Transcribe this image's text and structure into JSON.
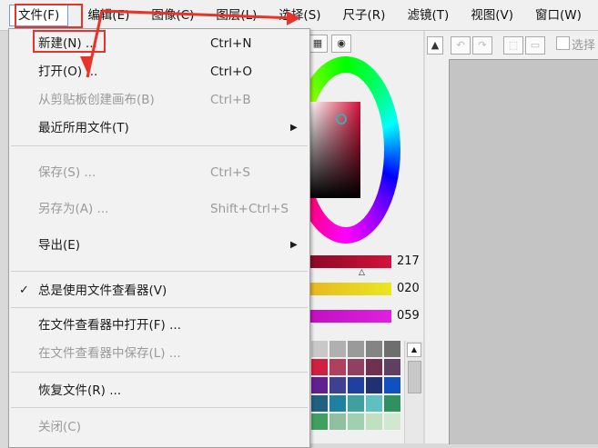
{
  "menubar": {
    "items": [
      {
        "label": "文件(F)",
        "active": true
      },
      {
        "label": "编辑(E)",
        "active": false
      },
      {
        "label": "图像(C)",
        "active": false
      },
      {
        "label": "图层(L)",
        "active": false
      },
      {
        "label": "选择(S)",
        "active": false
      },
      {
        "label": "尺子(R)",
        "active": false
      },
      {
        "label": "滤镜(T)",
        "active": false
      },
      {
        "label": "视图(V)",
        "active": false
      },
      {
        "label": "窗口(W)",
        "active": false
      }
    ]
  },
  "file_menu": {
    "new": {
      "label": "新建(N) ...",
      "shortcut": "Ctrl+N"
    },
    "open": {
      "label": "打开(O) ...",
      "shortcut": "Ctrl+O"
    },
    "from_clipboard": {
      "label": "从剪贴板创建画布(B)",
      "shortcut": "Ctrl+B"
    },
    "recent": {
      "label": "最近所用文件(T)"
    },
    "save": {
      "label": "保存(S) ...",
      "shortcut": "Ctrl+S"
    },
    "save_as": {
      "label": "另存为(A) ...",
      "shortcut": "Shift+Ctrl+S"
    },
    "export": {
      "label": "导出(E)"
    },
    "always_viewer": {
      "label": "总是使用文件查看器(V)",
      "checked": true
    },
    "open_in_viewer": {
      "label": "在文件查看器中打开(F) ..."
    },
    "save_in_viewer": {
      "label": "在文件查看器中保存(L) ..."
    },
    "recover": {
      "label": "恢复文件(R) ..."
    },
    "close": {
      "label": "关闭(C)"
    }
  },
  "color_panel": {
    "slider_values": [
      "217",
      "020",
      "059"
    ],
    "swatch_colors": [
      "#c8c8c8",
      "#b0b0b0",
      "#9a9a9a",
      "#848484",
      "#6e6e6e",
      "#d02040",
      "#b04060",
      "#904060",
      "#703050",
      "#604060",
      "#602090",
      "#404090",
      "#2040a0",
      "#203070",
      "#1050c0",
      "#206080",
      "#2080a0",
      "#40a0a0",
      "#60c0c0",
      "#309060",
      "#40a060",
      "#90c0a0",
      "#a0d0b0",
      "#c0e0c0",
      "#d0e8d0"
    ]
  },
  "right_panel": {
    "select_label": "选择"
  },
  "icons": {
    "submenu_arrow": "▶",
    "checkmark": "✓",
    "scroll_up": "▲"
  },
  "colors": {
    "highlight_box": "#e8332a",
    "active_menu_border": "#6aa0d8"
  }
}
